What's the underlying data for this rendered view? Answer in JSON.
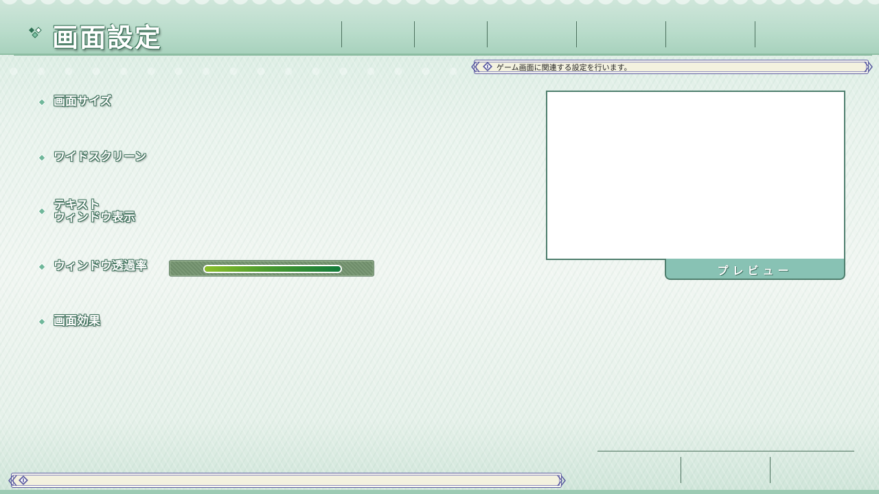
{
  "screen": {
    "title": "画面設定",
    "help_text": "ゲーム画面に関連する設定を行います。"
  },
  "settings": [
    {
      "label": "画面サイズ"
    },
    {
      "label": "ワイドスクリーン"
    },
    {
      "label_line1": "テキスト",
      "label_line2": "ウィンドウ表示"
    },
    {
      "label": "ウィンドウ透過率",
      "value_fraction": 1.0
    },
    {
      "label": "画面効果"
    }
  ],
  "preview": {
    "button_label": "プレビュー"
  },
  "colors": {
    "accent": "#88c2b4",
    "title_outline": "#2e6b4f",
    "banner_bg": "#f3f1df"
  },
  "icons": [
    "diamond-bullet-icon",
    "info-icon",
    "double-chevron-left-icon",
    "double-chevron-right-icon"
  ]
}
